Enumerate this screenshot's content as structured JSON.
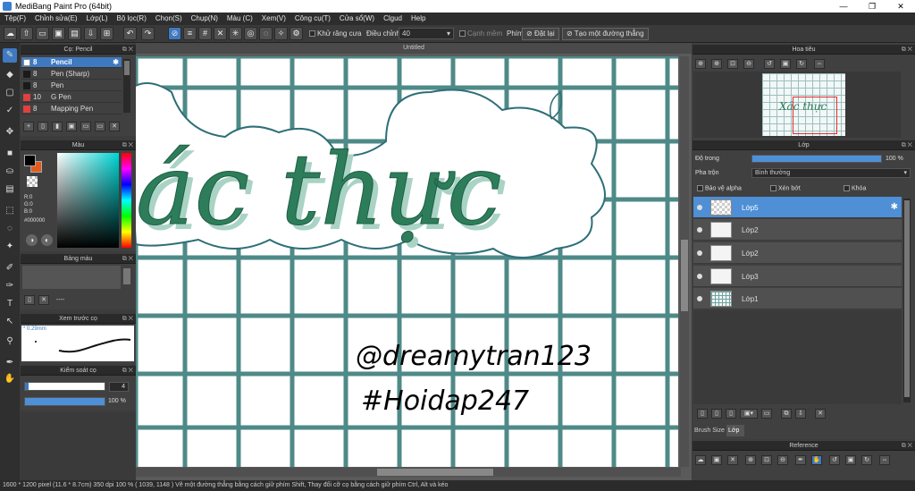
{
  "window": {
    "title": "MediBang Paint Pro (64bit)",
    "min": "—",
    "max": "❐",
    "close": "✕"
  },
  "menu": [
    "Tệp(F)",
    "Chỉnh sửa(E)",
    "Lớp(L)",
    "Bộ lọc(R)",
    "Chọn(S)",
    "Chụp(N)",
    "Màu (C)",
    "Xem(V)",
    "Công cụ(T)",
    "Cửa sổ(W)",
    "Clgud",
    "Help"
  ],
  "toolbar": {
    "antialias_label": "Khử răng cưa",
    "correction_label": "Điều chỉnh",
    "correction_value": "40",
    "soft_edge_label": "Cạnh mềm",
    "key_label": "Phím",
    "reset_label": "Đặt lại",
    "straight_label": "Tạo một đường thẳng"
  },
  "brush_panel": {
    "title": "Cọ: Pencil",
    "items": [
      {
        "size": "8",
        "name": "Pencil",
        "color": "#ffffff"
      },
      {
        "size": "8",
        "name": "Pen (Sharp)",
        "color": "#1a1a1a"
      },
      {
        "size": "8",
        "name": "Pen",
        "color": "#1a1a1a"
      },
      {
        "size": "10",
        "name": "G Pen",
        "color": "#e04040"
      },
      {
        "size": "8",
        "name": "Mapping Pen",
        "color": "#e04040"
      }
    ]
  },
  "color_panel": {
    "title": "Màu",
    "r": "R:0",
    "g": "G:0",
    "b": "B:0",
    "hex": "#000000"
  },
  "palette_panel": {
    "title": "Bảng màu",
    "placeholder": "----"
  },
  "preview_panel": {
    "title": "Xem trước cọ",
    "size": "0.29mm"
  },
  "brush_control": {
    "title": "Kiểm soát cọ",
    "size_value": "4",
    "opacity_value": "100 %",
    "size_frac": 0.04,
    "opacity_frac": 1.0
  },
  "canvas": {
    "tab": "Untitled",
    "main_text": "ác thực",
    "handle": "@dreamytran123",
    "hashtag": "#Hoidap247"
  },
  "navigator": {
    "title": "Hoa tiêu",
    "thumb_text": "Xác thực"
  },
  "layers_panel": {
    "title": "Lớp",
    "opacity_label": "Độ trong",
    "opacity_value": "100 %",
    "blend_label": "Pha trộn",
    "blend_value": "Bình thường",
    "protect_alpha": "Bảo vệ alpha",
    "clipping": "Xén bớt",
    "lock": "Khóa",
    "layers": [
      "Lớp5",
      "Lớp2",
      "Lớp2",
      "Lớp3",
      "Lớp1"
    ],
    "tab_brush_size": "Brush Size",
    "tab_layer": "Lớp"
  },
  "reference_panel": {
    "title": "Reference"
  },
  "status": "1600 * 1200 pixel  (11.6 * 8.7cm)  350 dpi  100 %  ( 1039, 1148 )  Vẽ một đường thẳng bằng cách giữ phím Shift, Thay đổi cỡ cọ bằng cách giữ phím Ctrl, Alt và kéo",
  "colors": {
    "accent": "#3f79c0",
    "grid": "#4e8a87",
    "lettering": "#2e7d5a",
    "shadow": "#a9d3c5"
  }
}
